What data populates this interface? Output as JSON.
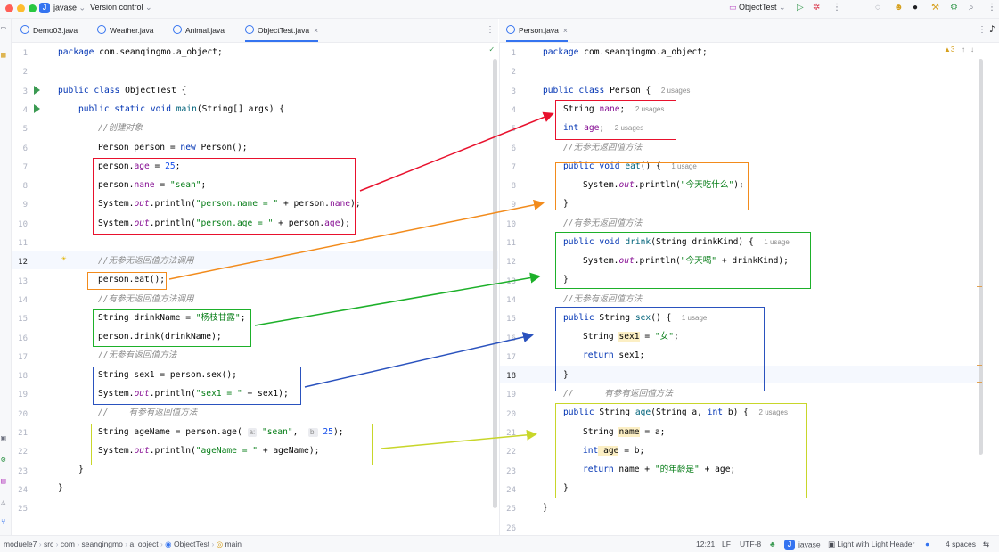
{
  "titlebar": {
    "project_badge": "J",
    "project": "javase",
    "vcs": "Version control",
    "run_config": "ObjectTest"
  },
  "left_tabs": [
    "Demo03.java",
    "Weather.java",
    "Animal.java",
    "ObjectTest.java"
  ],
  "right_tabs": [
    "Person.java"
  ],
  "left_editor": {
    "line_numbers": [
      "1",
      "2",
      "3",
      "4",
      "5",
      "6",
      "7",
      "8",
      "9",
      "10",
      "11",
      "12",
      "13",
      "14",
      "15",
      "16",
      "17",
      "18",
      "19",
      "20",
      "21",
      "22",
      "23",
      "24",
      "25"
    ],
    "lines": {
      "l1_kw": "package",
      "l1_rest": " com.seanqingmo.a_object;",
      "l3_kw": "public class",
      "l3_rest": " ObjectTest {",
      "l4_kw": "public static void",
      "l4_fn": " main",
      "l4_rest": "(String[] args) {",
      "l5": "//创建对象",
      "l6_a": "Person person = ",
      "l6_kw": "new",
      "l6_b": " Person();",
      "l7_a": "person.",
      "l7_f": "age",
      "l7_b": " = ",
      "l7_n": "25",
      "l7_c": ";",
      "l8_a": "person.",
      "l8_f": "nane",
      "l8_b": " = ",
      "l8_s": "\"sean\"",
      "l8_c": ";",
      "l9_a": "System.",
      "l9_st": "out",
      "l9_b": ".println(",
      "l9_s": "\"person.nane = \"",
      "l9_c": " + person.",
      "l9_f": "nane",
      "l9_d": ");",
      "l10_a": "System.",
      "l10_st": "out",
      "l10_b": ".println(",
      "l10_s": "\"person.age = \"",
      "l10_c": " + person.",
      "l10_f": "age",
      "l10_d": ");",
      "l12": "//无参无返回值方法调用",
      "l13": "person.eat();",
      "l14": "//有参无返回值方法调用",
      "l15_a": "String drinkName = ",
      "l15_s": "\"杨枝甘露\"",
      "l15_b": ";",
      "l16": "person.drink(drinkName);",
      "l17": "//无参有返回值方法",
      "l18": "String sex1 = person.sex();",
      "l19_a": "System.",
      "l19_st": "out",
      "l19_b": ".println(",
      "l19_s": "\"sex1 = \"",
      "l19_c": " + sex1);",
      "l20": "//    有参有返回值方法",
      "l21_a": "String ageName = person.age( ",
      "l21_h1": "a:",
      "l21_s": " \"sean\"",
      "l21_b": ",  ",
      "l21_h2": "b:",
      "l21_n": " 25",
      "l21_c": ");",
      "l22_a": "System.",
      "l22_st": "out",
      "l22_b": ".println(",
      "l22_s": "\"ageName = \"",
      "l22_c": " + ageName);",
      "l23": "}",
      "l24": "}"
    }
  },
  "right_editor": {
    "line_numbers": [
      "1",
      "2",
      "3",
      "4",
      "5",
      "6",
      "7",
      "8",
      "9",
      "10",
      "11",
      "12",
      "13",
      "14",
      "15",
      "16",
      "17",
      "18",
      "19",
      "20",
      "21",
      "22",
      "23",
      "24",
      "25",
      "26"
    ],
    "inspection": "▲3",
    "lines": {
      "l1_kw": "package",
      "l1_rest": " com.seanqingmo.a_object;",
      "l3_kw": "public class",
      "l3_rest": " Person {",
      "l3_hint": "2 usages",
      "l4_a": "String ",
      "l4_f": "nane",
      "l4_b": ";",
      "l4_hint": "2 usages",
      "l5_kw": "int",
      "l5_f": " age",
      "l5_b": ";",
      "l5_hint": "2 usages",
      "l6": "//无参无返回值方法",
      "l7_kw": "public void",
      "l7_fn": " eat",
      "l7_b": "() {",
      "l7_hint": "1 usage",
      "l8_a": "System.",
      "l8_st": "out",
      "l8_b": ".println(",
      "l8_s": "\"今天吃什么\"",
      "l8_c": ");",
      "l9": "}",
      "l10": "//有参无返回值方法",
      "l11_kw": "public void",
      "l11_fn": " drink",
      "l11_b": "(String drinkKind) {",
      "l11_hint": "1 usage",
      "l12_a": "System.",
      "l12_st": "out",
      "l12_b": ".println(",
      "l12_s": "\"今天喝\"",
      "l12_c": " + drinkKind);",
      "l13": "}",
      "l14": "//无参有返回值方法",
      "l15_kw": "public",
      "l15_a": " String ",
      "l15_fn": "sex",
      "l15_b": "() {",
      "l15_hint": "1 usage",
      "l16_a": "String ",
      "l16_v": "sex1",
      "l16_b": " = ",
      "l16_s": "\"女\"",
      "l16_c": ";",
      "l17_kw": "return",
      "l17_a": " sex1;",
      "l18": "}",
      "l19": "//      有参有返回值方法",
      "l20_kw": "public",
      "l20_a": " String ",
      "l20_fn": "age",
      "l20_b": "(String a, ",
      "l20_kw2": "int",
      "l20_c": " b) {",
      "l20_hint": "2 usages",
      "l21_a": "String ",
      "l21_v": "name",
      "l21_b": " = a;",
      "l22_kw": "int",
      "l22_v": " age",
      "l22_b": " = b;",
      "l23_kw": "return",
      "l23_a": " name + ",
      "l23_s": "\"的年龄是\"",
      "l23_b": " + age;",
      "l24": "}",
      "l25": "}"
    }
  },
  "statusbar": {
    "breadcrumb": [
      "moduele7",
      "src",
      "com",
      "seanqingmo",
      "a_object",
      "ObjectTest",
      "main"
    ],
    "position": "12:21",
    "line_sep": "LF",
    "encoding": "UTF-8",
    "project": "javase",
    "theme": "Light with Light Header",
    "indent": "4 spaces"
  },
  "colors": {
    "red": "#e8112d",
    "orange": "#f28b1c",
    "green": "#1db02a",
    "blue": "#2a52be",
    "lime": "#c8d62a"
  }
}
